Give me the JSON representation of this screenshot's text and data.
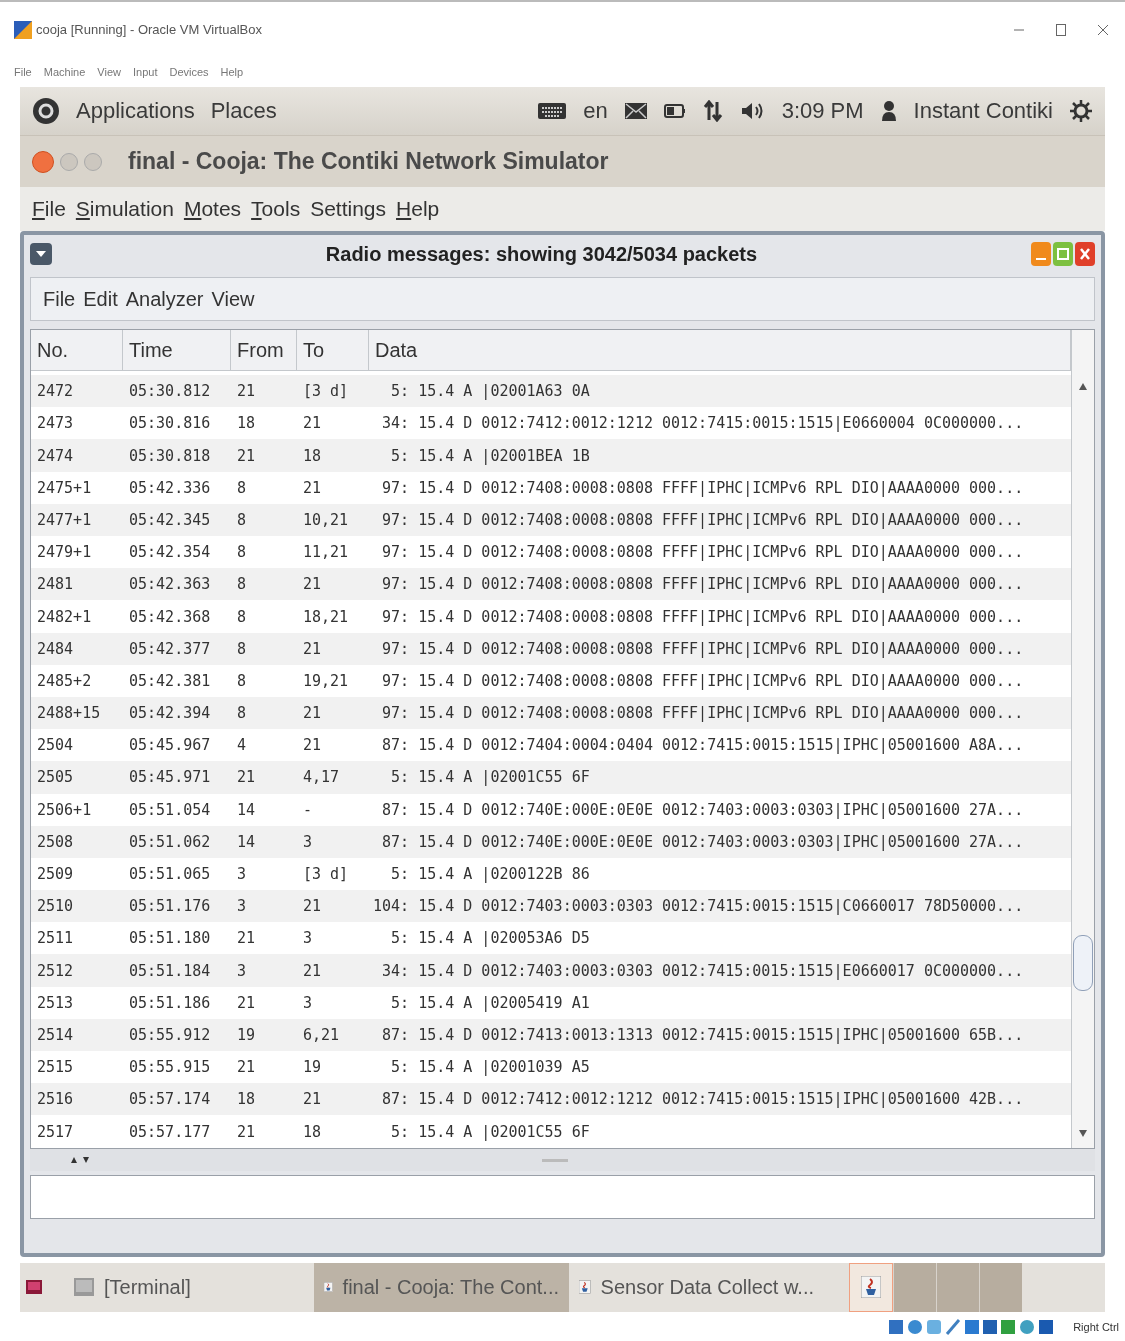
{
  "host_window": {
    "title": "cooja [Running] - Oracle VM VirtualBox",
    "menu": [
      "File",
      "Machine",
      "View",
      "Input",
      "Devices",
      "Help"
    ]
  },
  "top_panel": {
    "menus": [
      "Applications",
      "Places"
    ],
    "language": "en",
    "clock": "3:09 PM",
    "user": "Instant Contiki"
  },
  "cooja_window": {
    "title": "final - Cooja: The Contiki Network Simulator",
    "menu": [
      {
        "label": "File",
        "underlined_first": true
      },
      {
        "label": "Simulation",
        "underlined_first": true
      },
      {
        "label": "Motes",
        "underlined_first": true
      },
      {
        "label": "Tools",
        "underlined_first": true
      },
      {
        "label": "Settings",
        "underlined_first": false
      },
      {
        "label": "Help",
        "underlined_first": true
      }
    ]
  },
  "radio_messages": {
    "title": "Radio messages: showing 3042/5034 packets",
    "menu": [
      "File",
      "Edit",
      "Analyzer",
      "View"
    ],
    "columns": [
      "No.",
      "Time",
      "From",
      "To",
      "Data"
    ],
    "rows": [
      [
        "2472",
        "05:30.812",
        "21",
        "[3 d]",
        "  5: 15.4 A |02001A63 0A"
      ],
      [
        "2473",
        "05:30.816",
        "18",
        "21",
        " 34: 15.4 D 0012:7412:0012:1212 0012:7415:0015:1515|E0660004 0C000000..."
      ],
      [
        "2474",
        "05:30.818",
        "21",
        "18",
        "  5: 15.4 A |02001BEA 1B"
      ],
      [
        "2475+1",
        "05:42.336",
        "8",
        "21",
        " 97: 15.4 D 0012:7408:0008:0808 FFFF|IPHC|ICMPv6 RPL DIO|AAAA0000 000..."
      ],
      [
        "2477+1",
        "05:42.345",
        "8",
        "10,21",
        " 97: 15.4 D 0012:7408:0008:0808 FFFF|IPHC|ICMPv6 RPL DIO|AAAA0000 000..."
      ],
      [
        "2479+1",
        "05:42.354",
        "8",
        "11,21",
        " 97: 15.4 D 0012:7408:0008:0808 FFFF|IPHC|ICMPv6 RPL DIO|AAAA0000 000..."
      ],
      [
        "2481",
        "05:42.363",
        "8",
        "21",
        " 97: 15.4 D 0012:7408:0008:0808 FFFF|IPHC|ICMPv6 RPL DIO|AAAA0000 000..."
      ],
      [
        "2482+1",
        "05:42.368",
        "8",
        "18,21",
        " 97: 15.4 D 0012:7408:0008:0808 FFFF|IPHC|ICMPv6 RPL DIO|AAAA0000 000..."
      ],
      [
        "2484",
        "05:42.377",
        "8",
        "21",
        " 97: 15.4 D 0012:7408:0008:0808 FFFF|IPHC|ICMPv6 RPL DIO|AAAA0000 000..."
      ],
      [
        "2485+2",
        "05:42.381",
        "8",
        "19,21",
        " 97: 15.4 D 0012:7408:0008:0808 FFFF|IPHC|ICMPv6 RPL DIO|AAAA0000 000..."
      ],
      [
        "2488+15",
        "05:42.394",
        "8",
        "21",
        " 97: 15.4 D 0012:7408:0008:0808 FFFF|IPHC|ICMPv6 RPL DIO|AAAA0000 000..."
      ],
      [
        "2504",
        "05:45.967",
        "4",
        "21",
        " 87: 15.4 D 0012:7404:0004:0404 0012:7415:0015:1515|IPHC|05001600 A8A..."
      ],
      [
        "2505",
        "05:45.971",
        "21",
        "4,17",
        "  5: 15.4 A |02001C55 6F"
      ],
      [
        "2506+1",
        "05:51.054",
        "14",
        "-",
        " 87: 15.4 D 0012:740E:000E:0E0E 0012:7403:0003:0303|IPHC|05001600 27A..."
      ],
      [
        "2508",
        "05:51.062",
        "14",
        "3",
        " 87: 15.4 D 0012:740E:000E:0E0E 0012:7403:0003:0303|IPHC|05001600 27A..."
      ],
      [
        "2509",
        "05:51.065",
        "3",
        "[3 d]",
        "  5: 15.4 A |0200122B 86"
      ],
      [
        "2510",
        "05:51.176",
        "3",
        "21",
        "104: 15.4 D 0012:7403:0003:0303 0012:7415:0015:1515|C0660017 78D50000..."
      ],
      [
        "2511",
        "05:51.180",
        "21",
        "3",
        "  5: 15.4 A |020053A6 D5"
      ],
      [
        "2512",
        "05:51.184",
        "3",
        "21",
        " 34: 15.4 D 0012:7403:0003:0303 0012:7415:0015:1515|E0660017 0C000000..."
      ],
      [
        "2513",
        "05:51.186",
        "21",
        "3",
        "  5: 15.4 A |02005419 A1"
      ],
      [
        "2514",
        "05:55.912",
        "19",
        "6,21",
        " 87: 15.4 D 0012:7413:0013:1313 0012:7415:0015:1515|IPHC|05001600 65B..."
      ],
      [
        "2515",
        "05:55.915",
        "21",
        "19",
        "  5: 15.4 A |02001039 A5"
      ],
      [
        "2516",
        "05:57.174",
        "18",
        "21",
        " 87: 15.4 D 0012:7412:0012:1212 0012:7415:0015:1515|IPHC|05001600 42B..."
      ],
      [
        "2517",
        "05:57.177",
        "21",
        "18",
        "  5: 15.4 A |02001C55 6F"
      ]
    ]
  },
  "taskbar": [
    {
      "label": "[Terminal]",
      "kind": "terminal",
      "selected": false
    },
    {
      "label": "final - Cooja: The Cont...",
      "kind": "java",
      "selected": true
    },
    {
      "label": "Sensor Data Collect w...",
      "kind": "java",
      "selected": false
    }
  ],
  "status_bar": {
    "host_key": "Right Ctrl"
  }
}
